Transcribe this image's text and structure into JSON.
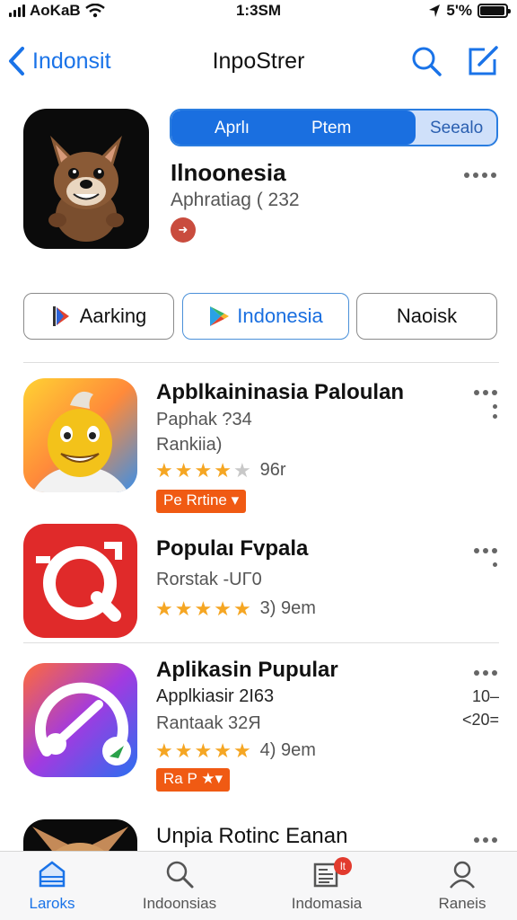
{
  "status_bar": {
    "carrier": "AoKaB",
    "time": "1:3SM",
    "battery": "5'%",
    "battery_level": 0.95
  },
  "nav": {
    "back_label": "Indonsit",
    "title": "InpoStrer"
  },
  "featured": {
    "segments": [
      "Aprlı",
      "Ptem",
      "Seealo"
    ],
    "title": "Ilnoonesia",
    "subtitle": "Aphratiag ( 232",
    "badge_icon": "arrow-badge-icon"
  },
  "chips": [
    {
      "label": "Aarking",
      "icon": "flag-icon"
    },
    {
      "label": "Indonesia",
      "icon": "play-store-icon"
    },
    {
      "label": "Naoisk",
      "icon": ""
    }
  ],
  "apps": [
    {
      "title": "Apblkaininasia Paloulan",
      "line1": "Paphak ?34",
      "line2": "Rankiia)",
      "rating": 4,
      "rating_count": "96r",
      "tag": "Pe Rrtine ▾",
      "icon": "cartoon-character-icon"
    },
    {
      "title": "Populaı Fvpala",
      "line1": "Rorstak -UΓ0",
      "rating": 4.5,
      "rating_count": "3) 9em",
      "icon": "camera-sync-icon"
    },
    {
      "title": "Aplikasin Pupular",
      "line1": "Applkiasir 2I63",
      "line2": "Rantaak 32Я",
      "rating": 4.5,
      "rating_count": "4) 9em",
      "tag": "Ra P ★▾",
      "side_numbers": [
        "10–",
        "<20="
      ],
      "icon": "speedometer-icon"
    },
    {
      "title": "Unpia Rotinc Eanan",
      "icon": "dog-icon"
    }
  ],
  "tabs": [
    {
      "label": "Laroks",
      "icon": "home-icon"
    },
    {
      "label": "Indoonsias",
      "icon": "search-icon"
    },
    {
      "label": "Indomasia",
      "icon": "news-icon",
      "badge": "lt"
    },
    {
      "label": "Raneis",
      "icon": "person-icon"
    }
  ],
  "colors": {
    "accent": "#1a73e8",
    "tag": "#f05a13",
    "star": "#f5a623"
  }
}
